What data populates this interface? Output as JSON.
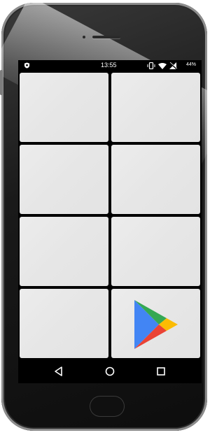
{
  "status_bar": {
    "time": "13:55",
    "battery": "44%",
    "icons": [
      "shield-icon",
      "vibrate-icon",
      "wifi-icon",
      "no-signal-icon"
    ]
  },
  "grid": {
    "tiles": [
      {
        "content": ""
      },
      {
        "content": ""
      },
      {
        "content": ""
      },
      {
        "content": ""
      },
      {
        "content": ""
      },
      {
        "content": ""
      },
      {
        "content": ""
      },
      {
        "content": "play-store-icon"
      }
    ]
  },
  "nav_bar": {
    "buttons": [
      "back-icon",
      "home-icon",
      "recents-icon"
    ]
  },
  "colors": {
    "tile": "#e8e8e8",
    "screen_bg": "#000000",
    "play_blue": "#4285f4",
    "play_green": "#34a853",
    "play_yellow": "#fbbc04",
    "play_red": "#ea4335"
  }
}
